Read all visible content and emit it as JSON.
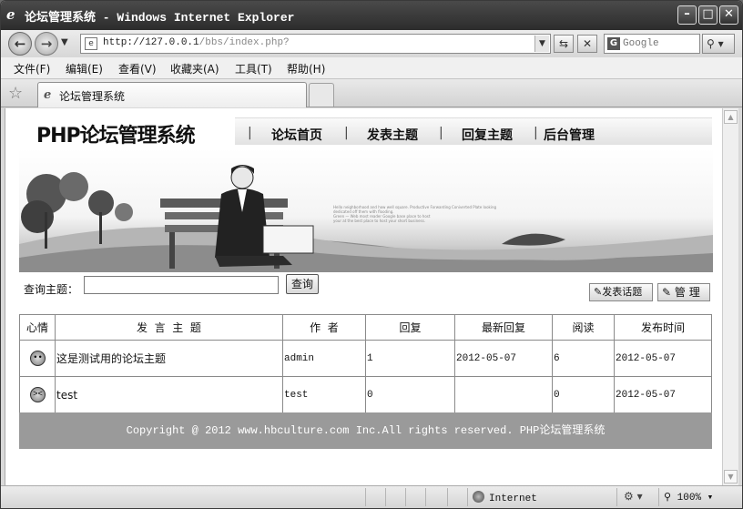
{
  "window": {
    "title": "论坛管理系统 - Windows Internet Explorer"
  },
  "address": {
    "url_host": "http://127.0.0.1",
    "url_path": "/bbs/index.php?",
    "search_placeholder": "Google"
  },
  "menu": {
    "items": [
      "文件(F)",
      "编辑(E)",
      "查看(V)",
      "收藏夹(A)",
      "工具(T)",
      "帮助(H)"
    ]
  },
  "tab": {
    "label": "论坛管理系统"
  },
  "page": {
    "logo": "PHP论坛管理系统",
    "nav": [
      "论坛首页",
      "发表主题",
      "回复主题",
      "后台管理"
    ],
    "banner_text": [
      "Hello neighborhood and how well square. Productive Forwarding Coniverted Plate looking",
      "dedicated off them with flooding.",
      "Green — Web most reader Google base place to host",
      "your at the best place to host your short business."
    ],
    "query_label": "查询主题：",
    "query_button": "查询",
    "post_button": "发表话题",
    "manage_button": "管 理",
    "table": {
      "headers": [
        "心情",
        "发  言  主  题",
        "作  者",
        "回复",
        "最新回复",
        "阅读",
        "发布时间"
      ],
      "rows": [
        {
          "mood": "😎",
          "subject": "这是测试用的论坛主题",
          "author": "admin",
          "replies": "1",
          "latest_reply": "2012-05-07",
          "reads": "6",
          "published": "2012-05-07"
        },
        {
          "mood": "😠",
          "subject": "test",
          "author": "test",
          "replies": "0",
          "latest_reply": "",
          "reads": "0",
          "published": "2012-05-07"
        }
      ]
    },
    "footer": "Copyright @ 2012 www.hbculture.com Inc.All rights reserved. PHP论坛管理系统"
  },
  "status": {
    "zone": "Internet",
    "zoom": "100%"
  }
}
